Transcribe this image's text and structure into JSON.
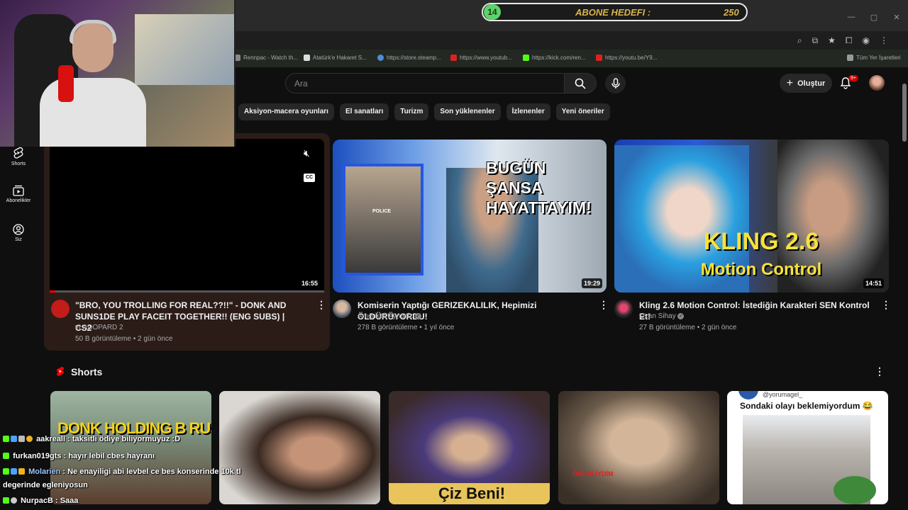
{
  "overlay": {
    "goal_level": "14",
    "goal_label": "ABONE HEDEFI :",
    "goal_value": "250"
  },
  "bookmarks": [
    {
      "label": "Rennpac - Watch th...",
      "color": "#888"
    },
    {
      "label": "Atatürk'e Hakaret S...",
      "color": "#ddd"
    },
    {
      "label": "https://store.steamp...",
      "color": "#4a8ed6"
    },
    {
      "label": "https://www.youtub...",
      "color": "#e02020"
    },
    {
      "label": "https://kick.com/ren...",
      "color": "#53fc18"
    },
    {
      "label": "https://youtu.be/Y9...",
      "color": "#e02020"
    },
    {
      "label": "Tüm Yer İşaretleri",
      "color": "#999"
    }
  ],
  "header": {
    "search_placeholder": "Ara",
    "create_label": "Oluştur",
    "notif_count": "9+"
  },
  "chips": [
    "Aksiyon-macera oyunları",
    "El sanatları",
    "Turizm",
    "Son yüklenenler",
    "İzlenenler",
    "Yeni öneriler"
  ],
  "nav": [
    {
      "label": "Shorts",
      "icon": "shorts-icon"
    },
    {
      "label": "Abonelikler",
      "icon": "subscriptions-icon"
    },
    {
      "label": "Siz",
      "icon": "you-icon"
    }
  ],
  "videos": [
    {
      "title": "\"BRO, YOU TROLLING FOR REAL??!!\" - DONK AND SUNS1DE PLAY FACEIT TOGETHER!! (ENG SUBS) | CS2",
      "channel": "vLADOPARD 2",
      "meta": "50 B görüntüleme • 2 gün önce",
      "duration": "16:55"
    },
    {
      "title": "Komiserin Yaptığı GERIZEKALILIK, Hepimizi ÖLDÜRÜYORDU!",
      "channel": "Amerikali Aynasiz",
      "meta": "278 B görüntüleme • 1 yıl önce",
      "duration": "19:29",
      "thumb_text": [
        "BUGÜN ŞANSA",
        "HAYATTAYIM!"
      ],
      "badge": "POLICE"
    },
    {
      "title": "Kling 2.6 Motion Control: İstediğin Karakteri SEN Kontrol Et!",
      "channel": "Ozan Sihay",
      "meta": "27 B görüntüleme • 2 gün önce",
      "duration": "14:51",
      "thumb_text": [
        "KLING 2.6",
        "Motion Control"
      ]
    }
  ],
  "shorts": {
    "heading": "Shorts",
    "items": [
      {
        "caption": "DONK HOLDING B RUSH"
      },
      {
        "caption": ""
      },
      {
        "caption": "Çiz Beni!"
      },
      {
        "caption": "ÖNEMLİYDİM"
      },
      {
        "caption": "Sondaki olayı beklemiyordum 😂",
        "handle": "@yorumagel_"
      }
    ]
  },
  "chat": [
    {
      "user": "aakreall",
      "message": ": taksitli ödiye biliyormuyuz :D"
    },
    {
      "user": "furkan019gts",
      "message": ": hayır lebil cbes hayranı"
    },
    {
      "user": "Molarien",
      "message": ": Ne enayiligi abi levbel ce bes konserinde 10k tl"
    },
    {
      "user": "",
      "message": "degerinde egleniyosun"
    },
    {
      "user": "NurpacB",
      "message": ": Saaa"
    }
  ],
  "colors": {
    "youtube_red": "#ff0000",
    "goal_text": "#d9b44a",
    "chat_green": "#53fc18"
  }
}
